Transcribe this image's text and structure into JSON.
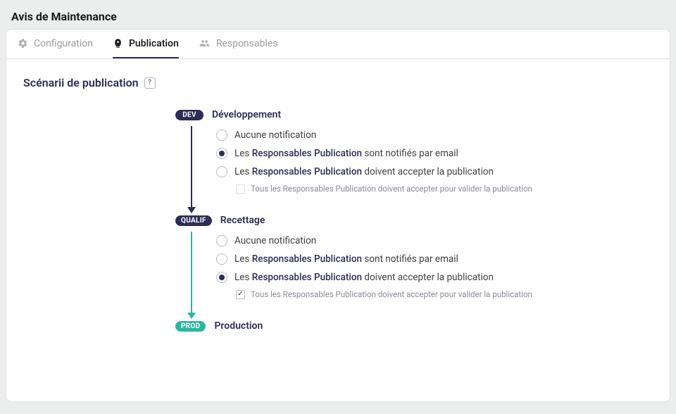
{
  "header": {
    "title": "Avis de Maintenance"
  },
  "tabs": [
    {
      "label": "Configuration",
      "active": false
    },
    {
      "label": "Publication",
      "active": true
    },
    {
      "label": "Responsables",
      "active": false
    }
  ],
  "section": {
    "title": "Scénarii de publication"
  },
  "stages": {
    "dev": {
      "badge": "DEV",
      "title": "Développement",
      "options": {
        "none": "Aucune notification",
        "notify_pre": "Les ",
        "notify_link": "Responsables Publication",
        "notify_post": " sont notifiés par email",
        "accept_pre": "Les ",
        "accept_link": "Responsables Publication",
        "accept_post": " doivent accepter la publication",
        "all_accept": "Tous les Responsables Publication doivent accepter pour valider la publication"
      },
      "selected": "notify",
      "all_accept_checked": false,
      "all_accept_disabled": true
    },
    "qualif": {
      "badge": "QUALIF",
      "title": "Recettage",
      "options": {
        "none": "Aucune notification",
        "notify_pre": "Les ",
        "notify_link": "Responsables Publication",
        "notify_post": " sont notifiés par email",
        "accept_pre": "Les ",
        "accept_link": "Responsables Publication",
        "accept_post": " doivent accepter la publication",
        "all_accept": "Tous les Responsables Publication doivent accepter pour valider la publication"
      },
      "selected": "accept",
      "all_accept_checked": true,
      "all_accept_disabled": false
    },
    "prod": {
      "badge": "PROD",
      "title": "Production"
    }
  }
}
